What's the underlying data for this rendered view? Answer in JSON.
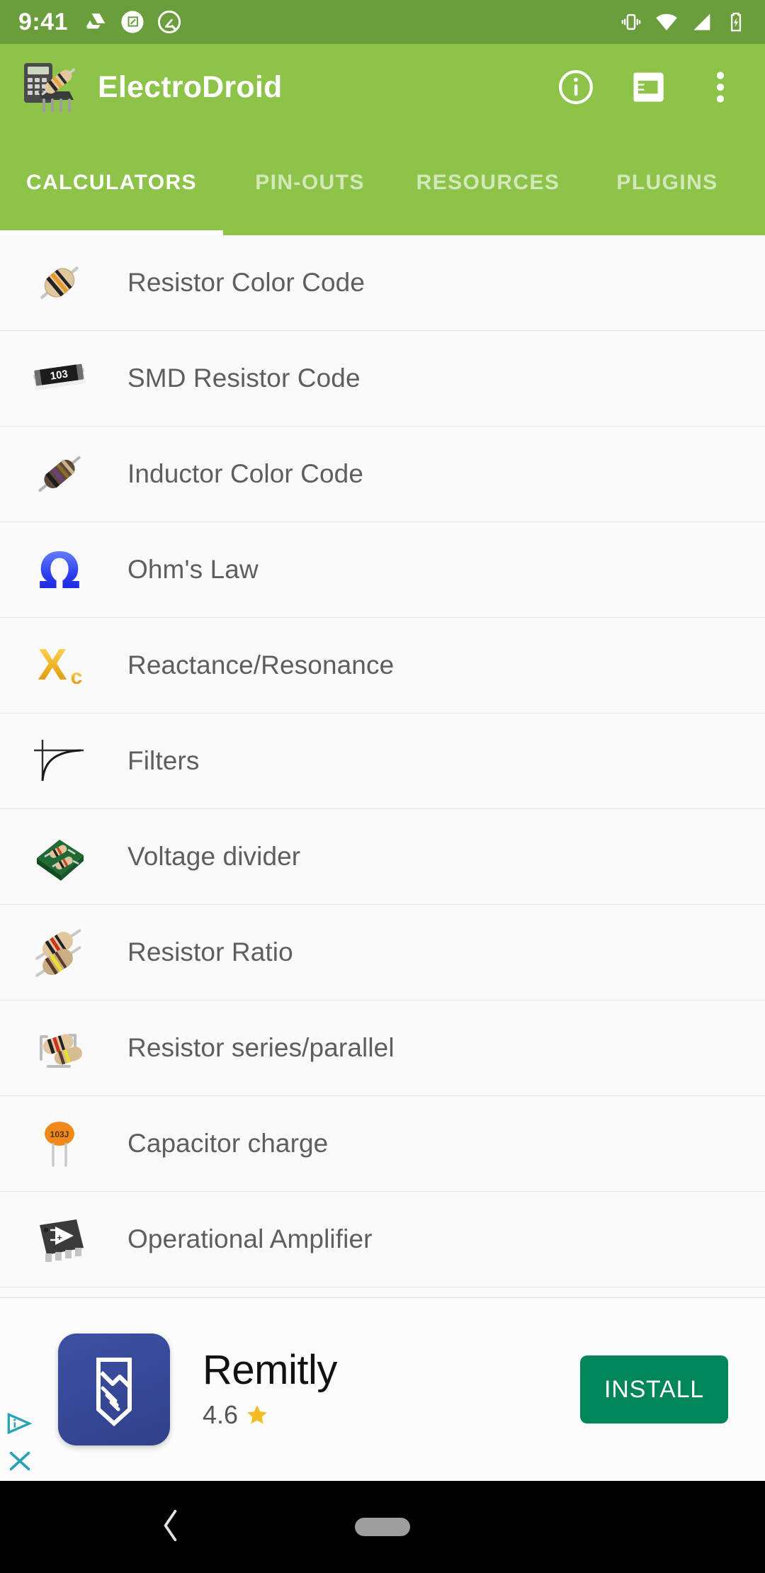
{
  "status_bar": {
    "time": "9:41",
    "left_icons": [
      "google-drive-icon",
      "screenshot-crop-icon",
      "android-q-icon"
    ],
    "right_icons": [
      "vibrate-icon",
      "wifi-icon",
      "cellular-signal-icon",
      "battery-charging-icon"
    ],
    "background_color": "#6a9d3b"
  },
  "app_bar": {
    "title": "ElectroDroid",
    "logo_icon": "calculator-resistor-logo",
    "background_color": "#8cc348",
    "actions": [
      {
        "name": "info-icon",
        "label": "Info"
      },
      {
        "name": "plug-connector-icon",
        "label": "Pro"
      },
      {
        "name": "overflow-menu-icon",
        "label": "More options"
      }
    ]
  },
  "tabs": {
    "active_index": 0,
    "items": [
      {
        "label": "CALCULATORS"
      },
      {
        "label": "PIN-OUTS"
      },
      {
        "label": "RESOURCES"
      },
      {
        "label": "PLUGINS"
      }
    ]
  },
  "calculator_list": [
    {
      "label": "Resistor Color Code",
      "icon": "axial-resistor-icon"
    },
    {
      "label": "SMD Resistor Code",
      "icon": "smd-resistor-103-icon"
    },
    {
      "label": "Inductor Color Code",
      "icon": "inductor-icon"
    },
    {
      "label": "Ohm's Law",
      "icon": "omega-icon"
    },
    {
      "label": "Reactance/Resonance",
      "icon": "xc-reactance-icon"
    },
    {
      "label": "Filters",
      "icon": "filter-curve-icon"
    },
    {
      "label": "Voltage divider",
      "icon": "pcb-board-icon"
    },
    {
      "label": "Resistor Ratio",
      "icon": "two-resistors-icon"
    },
    {
      "label": "Resistor series/parallel",
      "icon": "bent-resistors-icon"
    },
    {
      "label": "Capacitor charge",
      "icon": "ceramic-capacitor-icon"
    },
    {
      "label": "Operational Amplifier",
      "icon": "dip-opamp-icon"
    }
  ],
  "ad": {
    "app_name": "Remitly",
    "rating": "4.6",
    "star_icon": "star-icon",
    "install_label": "INSTALL",
    "install_color": "#00865a",
    "adchoices_icon": "adchoices-icon",
    "close_icon": "close-icon"
  },
  "nav_bar": {
    "back_icon": "back-chevron-icon",
    "home_icon": "home-pill-icon",
    "background_color": "#000000"
  }
}
